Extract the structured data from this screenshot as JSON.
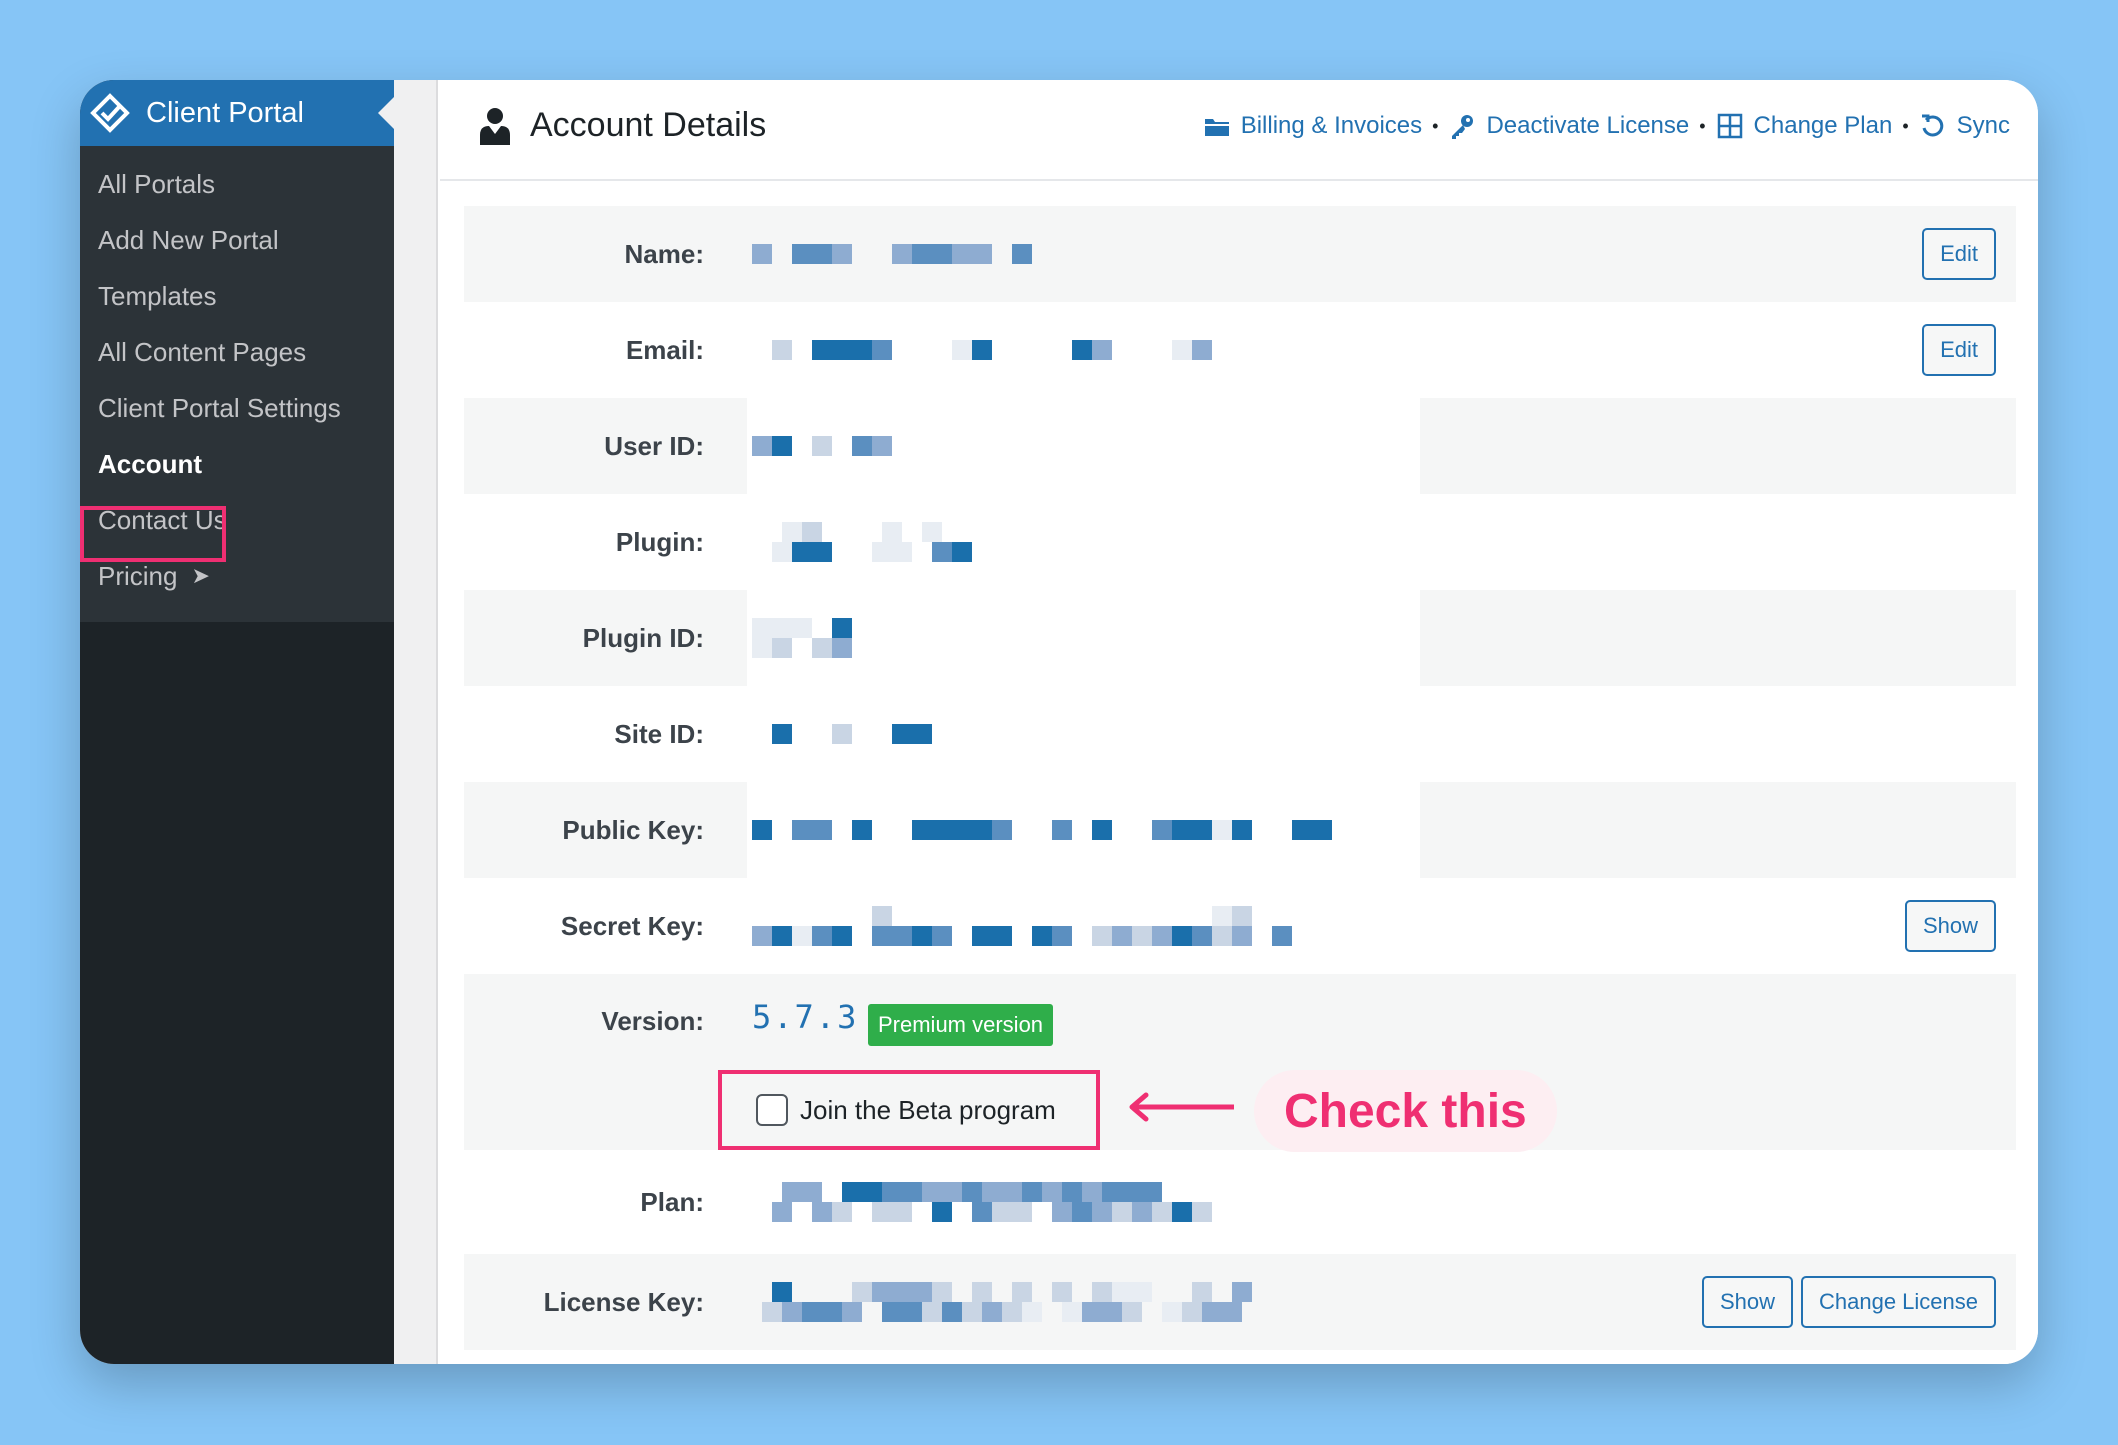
{
  "sidebar": {
    "title": "Client Portal",
    "items": [
      {
        "label": "All Portals"
      },
      {
        "label": "Add New Portal"
      },
      {
        "label": "Templates"
      },
      {
        "label": "All Content Pages"
      },
      {
        "label": "Client Portal Settings"
      },
      {
        "label": "Account"
      },
      {
        "label": "Contact Us"
      },
      {
        "label": "Pricing",
        "arrow": "➤"
      }
    ]
  },
  "header": {
    "title": "Account Details",
    "actions": [
      {
        "label": "Billing & Invoices",
        "icon": "folder-icon"
      },
      {
        "label": "Deactivate License",
        "icon": "key-icon"
      },
      {
        "label": "Change Plan",
        "icon": "grid-icon"
      },
      {
        "label": "Sync",
        "icon": "sync-icon"
      }
    ],
    "separator": "•"
  },
  "fields": {
    "name": {
      "label": "Name:",
      "button": "Edit"
    },
    "email": {
      "label": "Email:",
      "button": "Edit"
    },
    "user_id": {
      "label": "User ID:"
    },
    "plugin": {
      "label": "Plugin:"
    },
    "plugin_id": {
      "label": "Plugin ID:"
    },
    "site_id": {
      "label": "Site ID:"
    },
    "public_key": {
      "label": "Public Key:"
    },
    "secret_key": {
      "label": "Secret Key:",
      "button": "Show"
    },
    "version": {
      "label": "Version:",
      "value": "5.7.3",
      "badge": "Premium version"
    },
    "beta": {
      "label": "Join the Beta program",
      "checked": false
    },
    "plan": {
      "label": "Plan:"
    },
    "license_key": {
      "label": "License Key:",
      "buttons": [
        "Show",
        "Change License"
      ]
    }
  },
  "annotation": {
    "text": "Check this"
  },
  "colors": {
    "accent": "#2271b1",
    "highlight": "#ef2f72",
    "badge": "#2fae4a",
    "sidebar": "#1d2327"
  }
}
